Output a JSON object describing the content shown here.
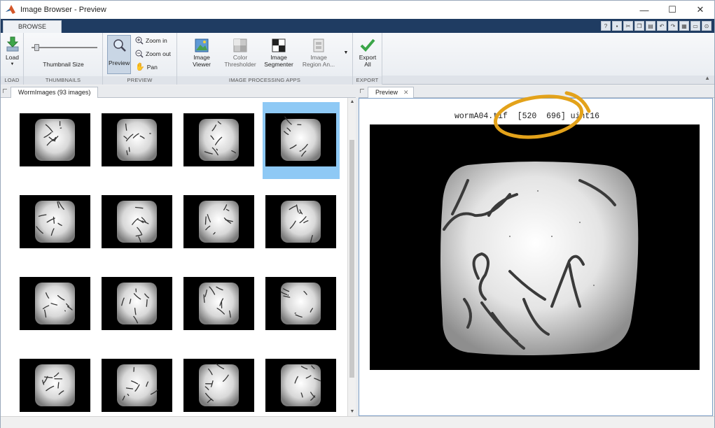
{
  "window": {
    "title": "Image Browser - Preview",
    "controls": {
      "minimize": "—",
      "maximize": "☐",
      "close": "✕"
    }
  },
  "ribbon": {
    "tab": "BROWSE",
    "groups": {
      "load": {
        "label": "LOAD",
        "button": "Load"
      },
      "thumbnails": {
        "label": "THUMBNAILS",
        "slider_label": "Thumbnail Size"
      },
      "preview": {
        "label": "PREVIEW",
        "button": "Preview",
        "zoom_in": "Zoom in",
        "zoom_out": "Zoom out",
        "pan": "Pan"
      },
      "apps": {
        "label": "IMAGE PROCESSING APPS",
        "items": [
          {
            "line1": "Image",
            "line2": "Viewer"
          },
          {
            "line1": "Color",
            "line2": "Thresholder"
          },
          {
            "line1": "Image",
            "line2": "Segmenter"
          },
          {
            "line1": "Image",
            "line2": "Region An..."
          }
        ]
      },
      "export": {
        "label": "EXPORT",
        "line1": "Export",
        "line2": "All"
      }
    }
  },
  "browser": {
    "tab_label": "WormImages (93 images)",
    "selected_index": 3
  },
  "preview": {
    "tab_label": "Preview",
    "caption": "wormA04.tif  [520  696] uint16"
  },
  "colors": {
    "selection": "#8ec9f5",
    "annotation": "#e3a21a",
    "titlebar_accent": "#1f3c62"
  }
}
